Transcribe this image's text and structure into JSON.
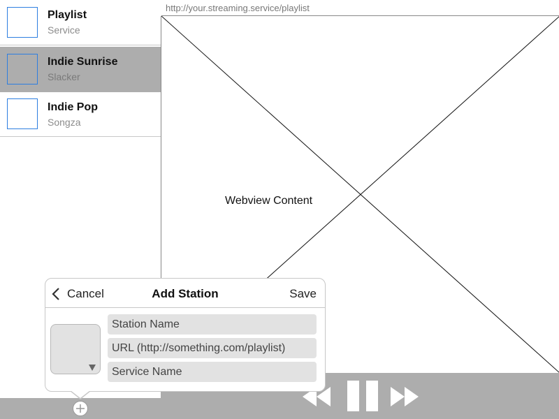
{
  "sidebar": {
    "items": [
      {
        "title": "Playlist",
        "subtitle": "Service"
      },
      {
        "title": "Indie Sunrise",
        "subtitle": "Slacker"
      },
      {
        "title": "Indie Pop",
        "subtitle": "Songza"
      }
    ]
  },
  "webview": {
    "url": "http://your.streaming.service/playlist",
    "placeholder_label": "Webview Content"
  },
  "popover": {
    "cancel_label": "Cancel",
    "title": "Add Station",
    "save_label": "Save",
    "station_name_placeholder": "Station Name",
    "url_placeholder": "URL (http://something.com/playlist)",
    "service_name_placeholder": "Service Name"
  },
  "player": {
    "controls": [
      "rewind-icon",
      "pause-icon",
      "fast-forward-icon"
    ]
  },
  "colors": {
    "selection": "#adadad",
    "thumb_border": "#2d7ee0",
    "field_bg": "#e2e2e2"
  }
}
